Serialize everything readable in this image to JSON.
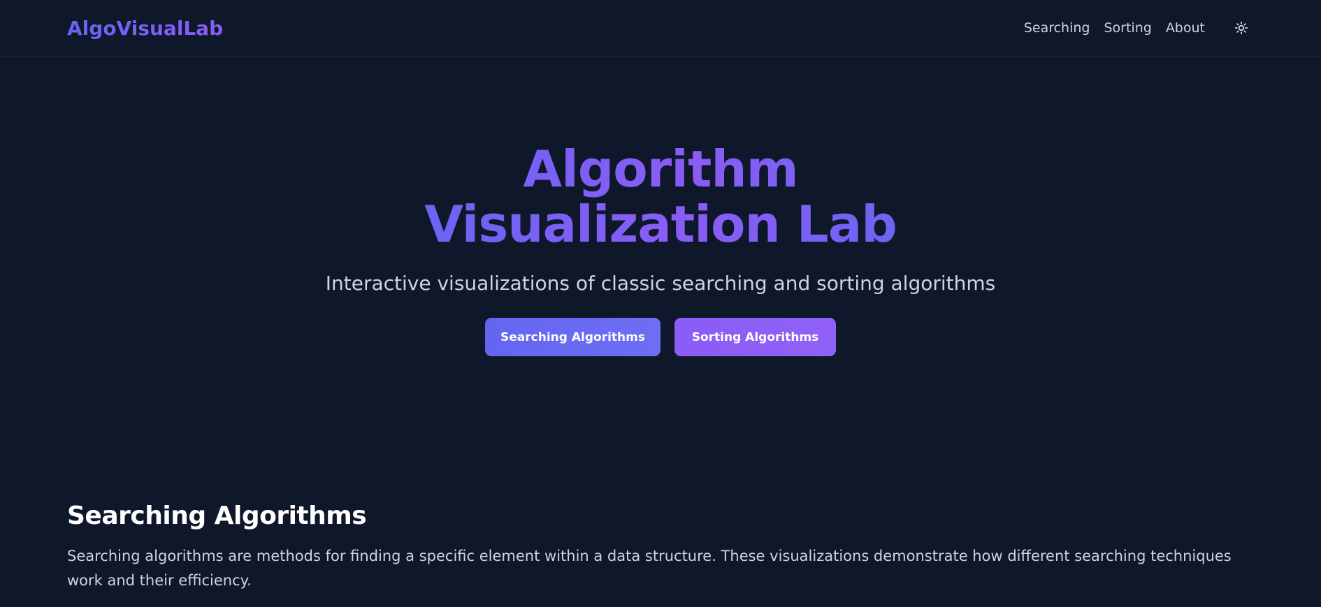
{
  "nav": {
    "brand": "AlgoVisualLab",
    "links": [
      "Searching",
      "Sorting",
      "About"
    ],
    "theme_icon": "sun-icon"
  },
  "hero": {
    "title": "Algorithm Visualization Lab",
    "subtitle": "Interactive visualizations of classic searching and sorting algorithms",
    "buttons": {
      "searching": "Searching Algorithms",
      "sorting": "Sorting Algorithms"
    }
  },
  "section": {
    "title": "Searching Algorithms",
    "text": "Searching algorithms are methods for finding a specific element within a data structure. These visualizations demonstrate how different searching techniques work and their efficiency."
  },
  "colors": {
    "background": "#0f172a",
    "accent_indigo": "#6366f1",
    "accent_violet": "#8b5cf6"
  }
}
